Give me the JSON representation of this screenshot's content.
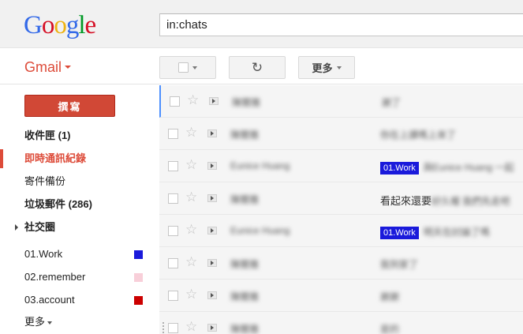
{
  "logo": {
    "letters": [
      "G",
      "o",
      "o",
      "g",
      "l",
      "e"
    ],
    "colors": [
      "#3369e8",
      "#d50f25",
      "#eeb211",
      "#3369e8",
      "#009925",
      "#d50f25"
    ]
  },
  "search": {
    "value": "in:chats"
  },
  "header": {
    "app_label": "Gmail"
  },
  "toolbar": {
    "refresh_glyph": "↻",
    "more_label": "更多"
  },
  "sidebar": {
    "compose_label": "撰寫",
    "items": [
      {
        "label": "收件匣 (1)"
      },
      {
        "label": "即時通訊紀錄"
      },
      {
        "label": "寄件備份"
      },
      {
        "label": "垃圾郵件 (286)"
      },
      {
        "label": "社交圈"
      },
      {
        "label": "01.Work",
        "color": "#1a1adb"
      },
      {
        "label": "02.remember",
        "color": "#f8cfd9"
      },
      {
        "label": "03.account",
        "color": "#cc0000"
      },
      {
        "label": "更多"
      }
    ]
  },
  "messages": [
    {
      "sender": "陳爾雅",
      "tag": "",
      "subject_clear": "",
      "subject_blur": "謝了"
    },
    {
      "sender": "陳爾雅",
      "tag": "",
      "subject_clear": "",
      "subject_blur": "你在上課嗎上來了"
    },
    {
      "sender": "Eunice Huang",
      "tag": "01.Work",
      "subject_clear": "",
      "subject_blur": "與Eunice Huang 一起"
    },
    {
      "sender": "陳爾雅",
      "tag": "",
      "subject_clear": "看起來還要",
      "subject_blur": "好久喔 我們先走吧"
    },
    {
      "sender": "Eunice Huang",
      "tag": "01.Work",
      "subject_clear": "",
      "subject_blur": "明天在討論了嗎"
    },
    {
      "sender": "陳爾雅",
      "tag": "",
      "subject_clear": "",
      "subject_blur": "我到家了"
    },
    {
      "sender": "陳爾雅",
      "tag": "",
      "subject_clear": "",
      "subject_blur": "謝謝"
    },
    {
      "sender": "陳爾雅",
      "tag": "",
      "subject_clear": "",
      "subject_blur": "是的"
    }
  ]
}
